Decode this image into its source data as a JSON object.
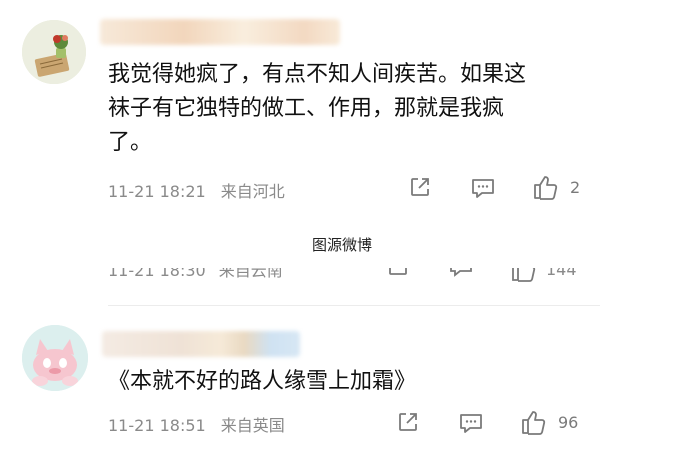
{
  "comments": [
    {
      "text_lines": [
        "我觉得她疯了，有点不知人间疾苦。如果这",
        "袜子有它独特的做工、作用，那就是我疯",
        "了。"
      ],
      "time": "11-21 18:21",
      "location": "来自河北",
      "likes": "2",
      "avatar_icon": "plant-desk-icon"
    },
    {
      "text_lines": [
        "《本就不好的路人缘雪上加霜》"
      ],
      "time": "11-21 18:51",
      "location": "来自英国",
      "likes": "96",
      "avatar_icon": "pink-cat-icon"
    }
  ],
  "caption": "图源微博",
  "cropped_comment": {
    "time": "11-21 18:30",
    "location": "来自云南",
    "likes": "144"
  },
  "colors": {
    "meta_gray": "#8a8a8a",
    "icon_gray": "#7a7a7a",
    "divider": "#ececec"
  }
}
